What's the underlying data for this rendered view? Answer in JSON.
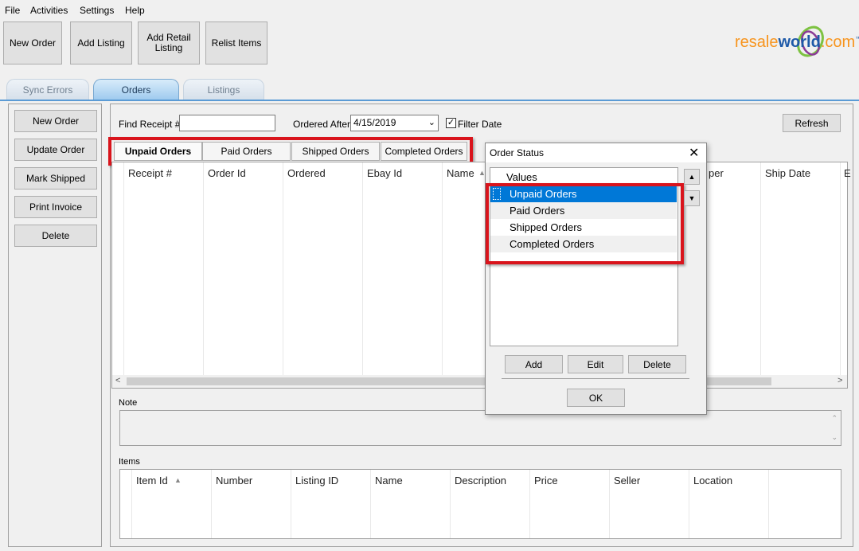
{
  "menu": [
    "File",
    "Activities",
    "Settings",
    "Help"
  ],
  "toolbar": {
    "new_order": "New Order",
    "add_listing": "Add Listing",
    "add_retail_listing": "Add Retail Listing",
    "relist_items": "Relist Items"
  },
  "logo": {
    "part1": "resale",
    "part2": "world",
    "part3": ".com",
    "tm": "™"
  },
  "tabs": [
    "Sync Errors",
    "Orders",
    "Listings"
  ],
  "active_tab": "Orders",
  "sidebar": [
    "New Order",
    "Update Order",
    "Mark Shipped",
    "Print Invoice",
    "Delete"
  ],
  "filters": {
    "find_receipt_label": "Find Receipt #",
    "find_receipt_value": "",
    "ordered_after_label": "Ordered After",
    "ordered_after_value": "4/15/2019",
    "filter_date_label": "Filter Date",
    "filter_date_checked": true,
    "refresh": "Refresh"
  },
  "order_tabs": [
    "Unpaid Orders",
    "Paid Orders",
    "Shipped Orders",
    "Completed Orders"
  ],
  "orders_columns": [
    "Receipt #",
    "Order Id",
    "Ordered",
    "Ebay Id",
    "Name",
    "per",
    "Ship Date",
    "E"
  ],
  "note_label": "Note",
  "items_label": "Items",
  "items_columns": [
    "Item Id",
    "Number",
    "Listing ID",
    "Name",
    "Description",
    "Price",
    "Seller",
    "Location"
  ],
  "dialog": {
    "title": "Order Status",
    "list_header": "Values",
    "options": [
      "Unpaid Orders",
      "Paid Orders",
      "Shipped Orders",
      "Completed Orders"
    ],
    "selected": "Unpaid Orders",
    "add": "Add",
    "edit": "Edit",
    "delete": "Delete",
    "ok": "OK"
  },
  "colors": {
    "highlight": "#d9141c",
    "selection": "#0078d7",
    "tab_active": "#9dc9ee"
  }
}
